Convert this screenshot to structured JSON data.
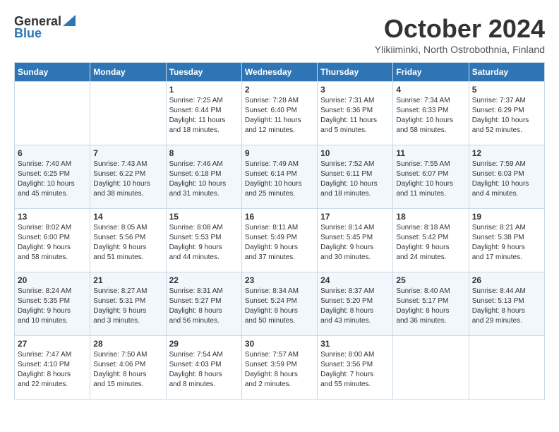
{
  "logo": {
    "general": "General",
    "blue": "Blue"
  },
  "title": "October 2024",
  "location": "Ylikiiminki, North Ostrobothnia, Finland",
  "headers": [
    "Sunday",
    "Monday",
    "Tuesday",
    "Wednesday",
    "Thursday",
    "Friday",
    "Saturday"
  ],
  "weeks": [
    [
      {
        "day": "",
        "info": ""
      },
      {
        "day": "",
        "info": ""
      },
      {
        "day": "1",
        "info": "Sunrise: 7:25 AM\nSunset: 6:44 PM\nDaylight: 11 hours\nand 18 minutes."
      },
      {
        "day": "2",
        "info": "Sunrise: 7:28 AM\nSunset: 6:40 PM\nDaylight: 11 hours\nand 12 minutes."
      },
      {
        "day": "3",
        "info": "Sunrise: 7:31 AM\nSunset: 6:36 PM\nDaylight: 11 hours\nand 5 minutes."
      },
      {
        "day": "4",
        "info": "Sunrise: 7:34 AM\nSunset: 6:33 PM\nDaylight: 10 hours\nand 58 minutes."
      },
      {
        "day": "5",
        "info": "Sunrise: 7:37 AM\nSunset: 6:29 PM\nDaylight: 10 hours\nand 52 minutes."
      }
    ],
    [
      {
        "day": "6",
        "info": "Sunrise: 7:40 AM\nSunset: 6:25 PM\nDaylight: 10 hours\nand 45 minutes."
      },
      {
        "day": "7",
        "info": "Sunrise: 7:43 AM\nSunset: 6:22 PM\nDaylight: 10 hours\nand 38 minutes."
      },
      {
        "day": "8",
        "info": "Sunrise: 7:46 AM\nSunset: 6:18 PM\nDaylight: 10 hours\nand 31 minutes."
      },
      {
        "day": "9",
        "info": "Sunrise: 7:49 AM\nSunset: 6:14 PM\nDaylight: 10 hours\nand 25 minutes."
      },
      {
        "day": "10",
        "info": "Sunrise: 7:52 AM\nSunset: 6:11 PM\nDaylight: 10 hours\nand 18 minutes."
      },
      {
        "day": "11",
        "info": "Sunrise: 7:55 AM\nSunset: 6:07 PM\nDaylight: 10 hours\nand 11 minutes."
      },
      {
        "day": "12",
        "info": "Sunrise: 7:59 AM\nSunset: 6:03 PM\nDaylight: 10 hours\nand 4 minutes."
      }
    ],
    [
      {
        "day": "13",
        "info": "Sunrise: 8:02 AM\nSunset: 6:00 PM\nDaylight: 9 hours\nand 58 minutes."
      },
      {
        "day": "14",
        "info": "Sunrise: 8:05 AM\nSunset: 5:56 PM\nDaylight: 9 hours\nand 51 minutes."
      },
      {
        "day": "15",
        "info": "Sunrise: 8:08 AM\nSunset: 5:53 PM\nDaylight: 9 hours\nand 44 minutes."
      },
      {
        "day": "16",
        "info": "Sunrise: 8:11 AM\nSunset: 5:49 PM\nDaylight: 9 hours\nand 37 minutes."
      },
      {
        "day": "17",
        "info": "Sunrise: 8:14 AM\nSunset: 5:45 PM\nDaylight: 9 hours\nand 30 minutes."
      },
      {
        "day": "18",
        "info": "Sunrise: 8:18 AM\nSunset: 5:42 PM\nDaylight: 9 hours\nand 24 minutes."
      },
      {
        "day": "19",
        "info": "Sunrise: 8:21 AM\nSunset: 5:38 PM\nDaylight: 9 hours\nand 17 minutes."
      }
    ],
    [
      {
        "day": "20",
        "info": "Sunrise: 8:24 AM\nSunset: 5:35 PM\nDaylight: 9 hours\nand 10 minutes."
      },
      {
        "day": "21",
        "info": "Sunrise: 8:27 AM\nSunset: 5:31 PM\nDaylight: 9 hours\nand 3 minutes."
      },
      {
        "day": "22",
        "info": "Sunrise: 8:31 AM\nSunset: 5:27 PM\nDaylight: 8 hours\nand 56 minutes."
      },
      {
        "day": "23",
        "info": "Sunrise: 8:34 AM\nSunset: 5:24 PM\nDaylight: 8 hours\nand 50 minutes."
      },
      {
        "day": "24",
        "info": "Sunrise: 8:37 AM\nSunset: 5:20 PM\nDaylight: 8 hours\nand 43 minutes."
      },
      {
        "day": "25",
        "info": "Sunrise: 8:40 AM\nSunset: 5:17 PM\nDaylight: 8 hours\nand 36 minutes."
      },
      {
        "day": "26",
        "info": "Sunrise: 8:44 AM\nSunset: 5:13 PM\nDaylight: 8 hours\nand 29 minutes."
      }
    ],
    [
      {
        "day": "27",
        "info": "Sunrise: 7:47 AM\nSunset: 4:10 PM\nDaylight: 8 hours\nand 22 minutes."
      },
      {
        "day": "28",
        "info": "Sunrise: 7:50 AM\nSunset: 4:06 PM\nDaylight: 8 hours\nand 15 minutes."
      },
      {
        "day": "29",
        "info": "Sunrise: 7:54 AM\nSunset: 4:03 PM\nDaylight: 8 hours\nand 8 minutes."
      },
      {
        "day": "30",
        "info": "Sunrise: 7:57 AM\nSunset: 3:59 PM\nDaylight: 8 hours\nand 2 minutes."
      },
      {
        "day": "31",
        "info": "Sunrise: 8:00 AM\nSunset: 3:56 PM\nDaylight: 7 hours\nand 55 minutes."
      },
      {
        "day": "",
        "info": ""
      },
      {
        "day": "",
        "info": ""
      }
    ]
  ]
}
